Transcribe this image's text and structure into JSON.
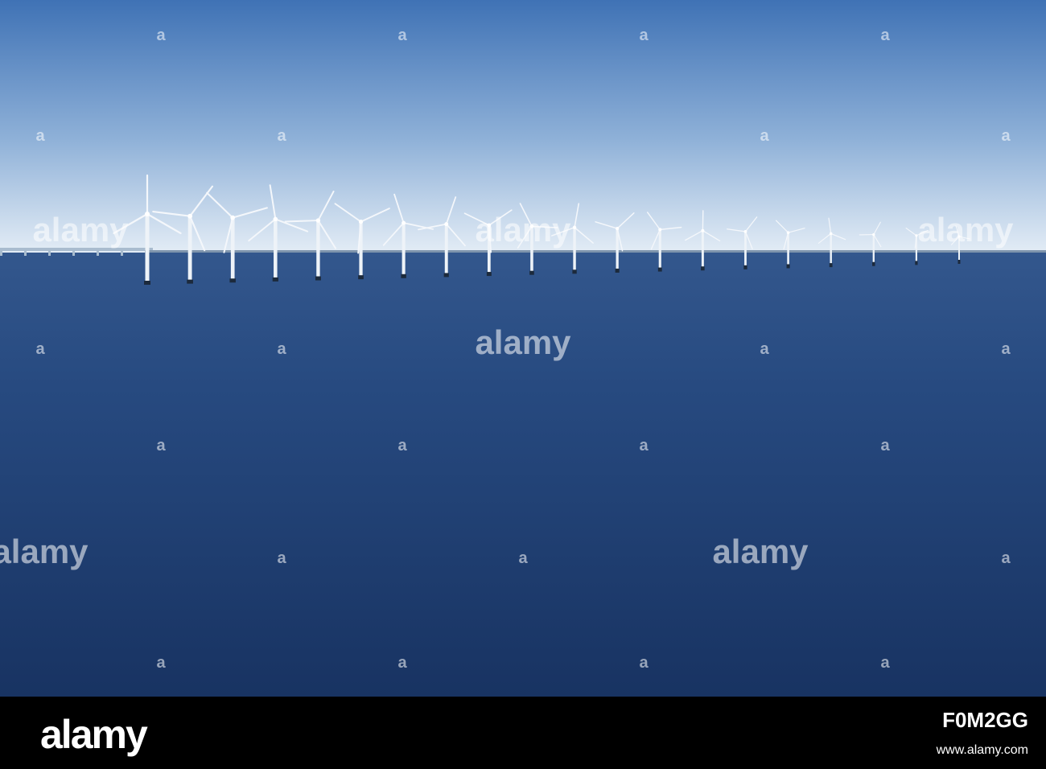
{
  "photo": {
    "description_colors": {
      "sky_top": "#3f72b5",
      "sky_horizon": "#dfe9f4",
      "sea_top": "#2e5187",
      "sea_bottom": "#1a3663"
    },
    "turbine_count": 20,
    "watermarks": [
      "alamy",
      "alamy",
      "alamy",
      "alamy",
      "alamy",
      "alamy",
      "alamy",
      "alamy",
      "alamy",
      "alamy",
      "alamy",
      "alamy",
      "alamy",
      "alamy",
      "alamy"
    ]
  },
  "footer": {
    "logo": "alamy",
    "image_id": "F0M2GG",
    "url": "www.alamy.com"
  }
}
